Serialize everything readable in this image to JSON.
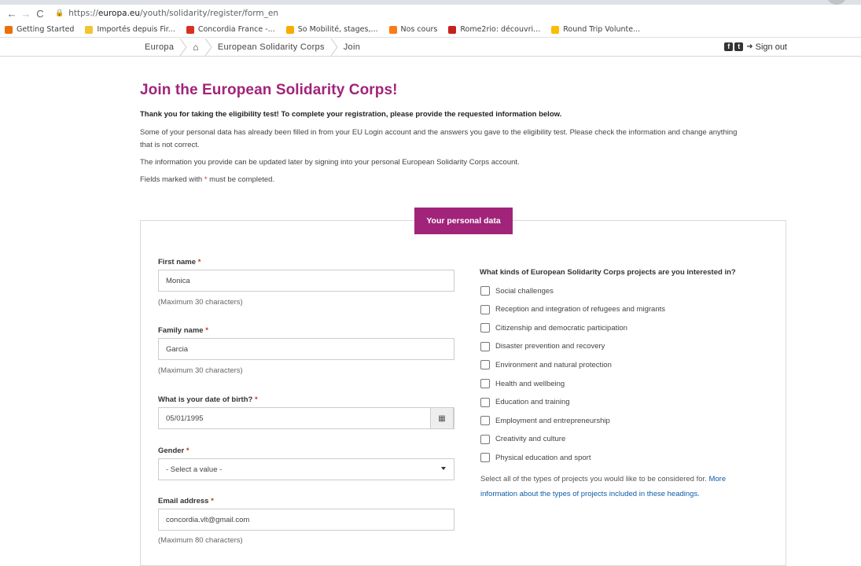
{
  "browser": {
    "url_prefix": "https://",
    "url_domain": "europa.eu",
    "url_path": "/youth/solidarity/register/form_en",
    "bookmarks": [
      {
        "label": "Getting Started",
        "color": "#e8710a"
      },
      {
        "label": "Importés depuis Fir...",
        "color": "#f4c430"
      },
      {
        "label": "Concordia France -...",
        "color": "#d93025"
      },
      {
        "label": "So Mobilité, stages,...",
        "color": "#f9ab00"
      },
      {
        "label": "Nos cours",
        "color": "#fa7b17"
      },
      {
        "label": "Rome2rio: découvri...",
        "color": "#c5221f"
      },
      {
        "label": "Round Trip Volunte...",
        "color": "#fbbc04"
      }
    ]
  },
  "site": {
    "breadcrumb": {
      "europa": "Europa",
      "section": "European Solidarity Corps",
      "current": "Join"
    },
    "sign_out": "Sign out"
  },
  "page": {
    "title": "Join the European Solidarity Corps!",
    "intro_bold": "Thank you for taking the eligibility test! To complete your registration, please provide the requested information below.",
    "para1a": "Some of your personal data has already been filled in from your EU Login account and the answers you gave to the eligibility test. Please check the information and change anything",
    "para1b": "that is not correct.",
    "para2": "The information you provide can be updated later by signing into your personal European Solidarity Corps account.",
    "para3_pre": "Fields marked with ",
    "para3_post": " must be completed.",
    "asterisk": "*"
  },
  "panel": {
    "tab": "Your personal data",
    "first_name": {
      "label": "First name",
      "value": "Monica",
      "help": "(Maximum 30 characters)"
    },
    "family_name": {
      "label": "Family name",
      "value": "Garcia",
      "help": "(Maximum 30 characters)"
    },
    "dob": {
      "label": "What is your date of birth?",
      "value": "05/01/1995"
    },
    "gender": {
      "label": "Gender",
      "value": "- Select a value -"
    },
    "email": {
      "label": "Email address",
      "value": "concordia.vlt@gmail.com",
      "help": "(Maximum 80 characters)"
    },
    "projects": {
      "question": "What kinds of European Solidarity Corps projects are you interested in?",
      "options": [
        "Social challenges",
        "Reception and integration of refugees and migrants",
        "Citizenship and democratic participation",
        "Disaster prevention and recovery",
        "Environment and natural protection",
        "Health and wellbeing",
        "Education and training",
        "Employment and entrepreneurship",
        "Creativity and culture",
        "Physical education and sport"
      ],
      "note_text": "Select all of the types of projects you would like to be considered for. ",
      "note_link": "More information about the types of projects included in these headings."
    }
  },
  "colors": {
    "brand": "#a1247a",
    "link": "#0e5ca8"
  }
}
